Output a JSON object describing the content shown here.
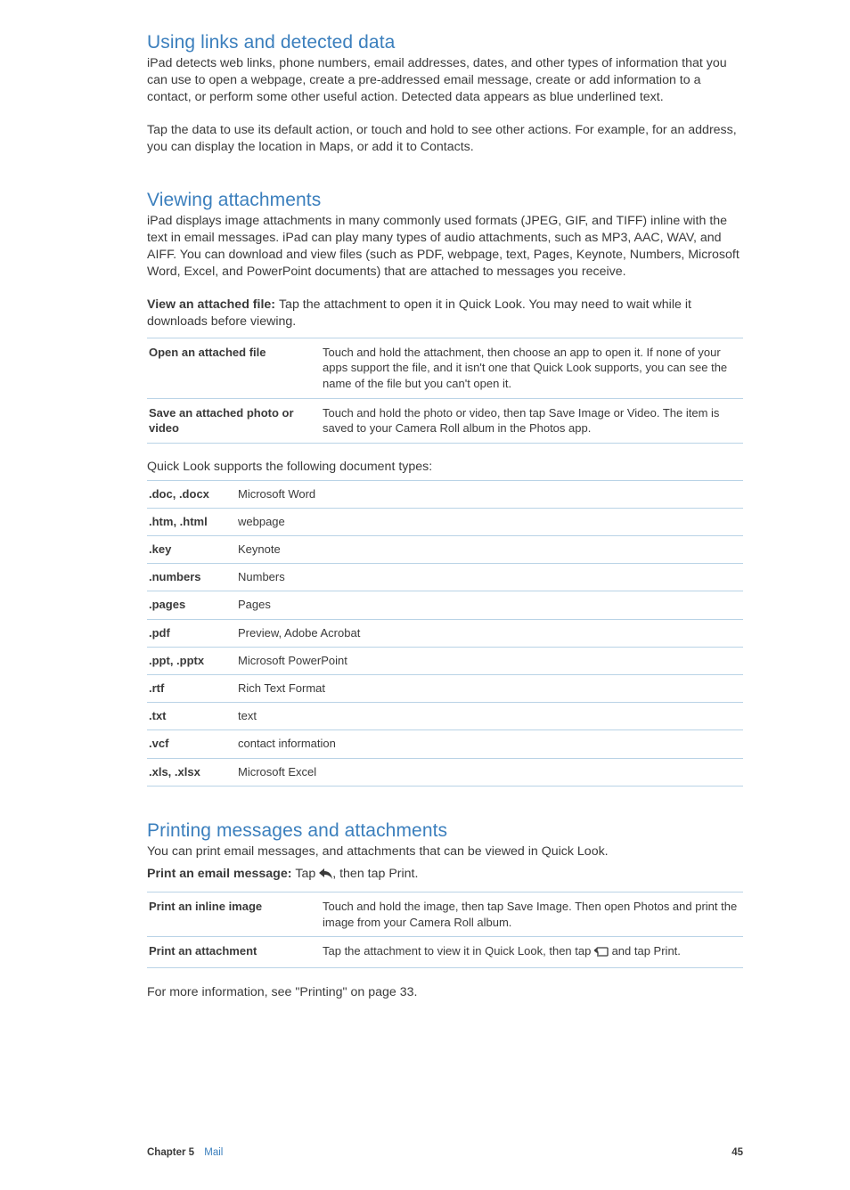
{
  "sections": {
    "links": {
      "heading": "Using links and detected data",
      "p1": "iPad detects web links, phone numbers, email addresses, dates, and other types of information that you can use to open a webpage, create a pre-addressed email message, create or add information to a contact, or perform some other useful action. Detected data appears as blue underlined text.",
      "p2": "Tap the data to use its default action, or touch and hold to see other actions. For example, for an address, you can display the location in Maps, or add it to Contacts."
    },
    "attachments": {
      "heading": "Viewing attachments",
      "p1": "iPad displays image attachments in many commonly used formats (JPEG, GIF, and TIFF) inline with the text in email messages. iPad can play many types of audio attachments, such as MP3, AAC, WAV, and AIFF. You can download and view files (such as PDF, webpage, text, Pages, Keynote, Numbers, Microsoft Word, Excel, and PowerPoint documents) that are attached to messages you receive.",
      "view_label": "View an attached file:  ",
      "view_desc": "Tap the attachment to open it in Quick Look. You may need to wait while it downloads before viewing.",
      "table": [
        {
          "label": "Open an attached file",
          "desc": "Touch and hold the attachment, then choose an app to open it. If none of your apps support the file, and it isn't one that Quick Look supports, you can see the name of the file but you can't open it."
        },
        {
          "label": "Save an attached photo or video",
          "desc": "Touch and hold the photo or video, then tap Save Image or Video. The item is saved to your Camera Roll album in the Photos app."
        }
      ],
      "quicklook_intro": "Quick Look supports the following document types:",
      "filetypes": [
        {
          "ext": ".doc, .docx",
          "desc": "Microsoft Word"
        },
        {
          "ext": ".htm, .html",
          "desc": "webpage"
        },
        {
          "ext": ".key",
          "desc": "Keynote"
        },
        {
          "ext": ".numbers",
          "desc": "Numbers"
        },
        {
          "ext": ".pages",
          "desc": "Pages"
        },
        {
          "ext": ".pdf",
          "desc": "Preview, Adobe Acrobat"
        },
        {
          "ext": ".ppt, .pptx",
          "desc": "Microsoft PowerPoint"
        },
        {
          "ext": ".rtf",
          "desc": "Rich Text Format"
        },
        {
          "ext": ".txt",
          "desc": "text"
        },
        {
          "ext": ".vcf",
          "desc": "contact information"
        },
        {
          "ext": ".xls, .xlsx",
          "desc": "Microsoft Excel"
        }
      ]
    },
    "printing": {
      "heading": "Printing messages and attachments",
      "p1": "You can print email messages, and attachments that can be viewed in Quick Look.",
      "print_label": "Print an email message:  ",
      "print_desc_pre": "Tap ",
      "print_desc_post": ", then tap Print.",
      "table": [
        {
          "label": "Print an inline image",
          "desc": "Touch and hold the image, then tap Save Image. Then open Photos and print the image from your Camera Roll album."
        },
        {
          "label": "Print an attachment",
          "desc_pre": "Tap the attachment to view it in Quick Look, then tap ",
          "desc_post": " and tap Print."
        }
      ],
      "more_info": "For more information, see \"Printing\" on page 33."
    }
  },
  "footer": {
    "chapter_label": "Chapter 5",
    "chapter_title": "Mail",
    "page_number": "45"
  }
}
